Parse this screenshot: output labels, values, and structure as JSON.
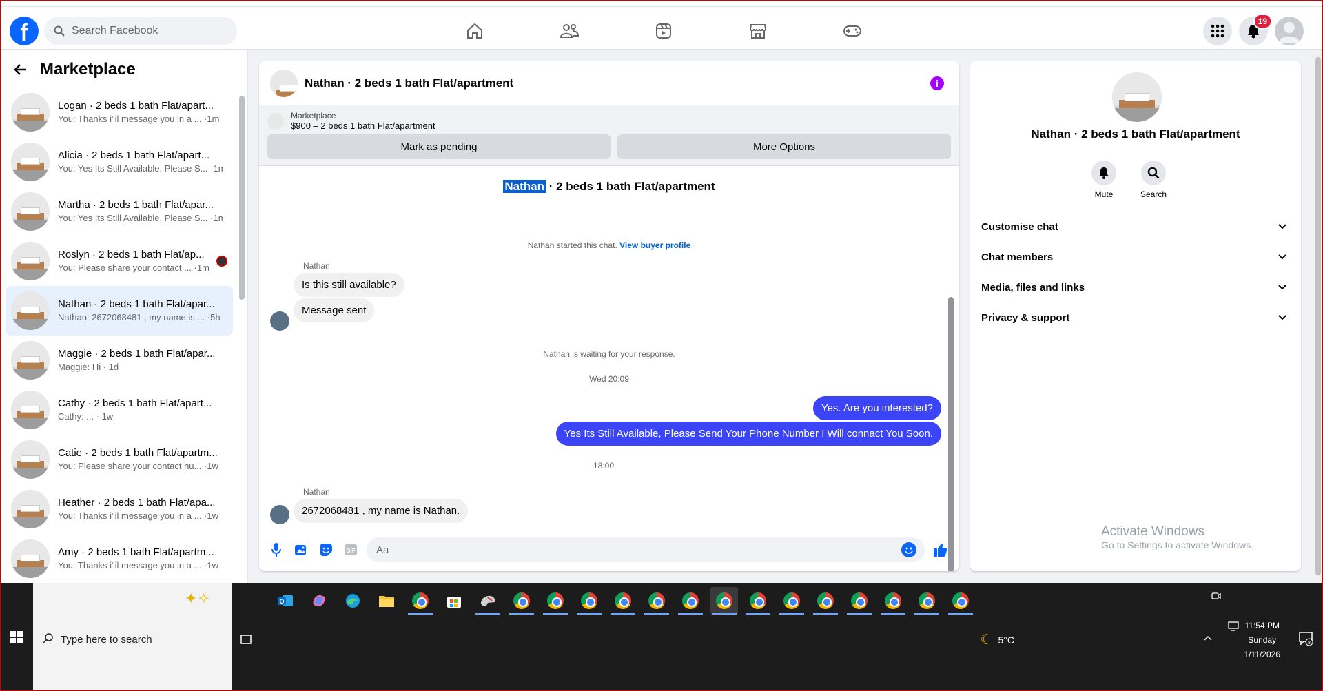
{
  "header": {
    "logo": "f",
    "search_placeholder": "Search Facebook",
    "nav": [
      "home-icon",
      "friends-icon",
      "watch-icon",
      "marketplace-icon",
      "gaming-icon"
    ],
    "notif_count": "19"
  },
  "sidebar": {
    "title": "Marketplace",
    "conversations": [
      {
        "title": "Logan · 2 beds 1 bath Flat/apart...",
        "sub": "You: Thanks i\"il message you in a ... ·1m"
      },
      {
        "title": "Alicia · 2 beds 1 bath Flat/apart...",
        "sub": "You: Yes Its Still Available, Please S... ·1m"
      },
      {
        "title": "Martha · 2 beds 1 bath Flat/apar...",
        "sub": "You: Yes Its Still Available, Please S... ·1m"
      },
      {
        "title": "Roslyn · 2 beds 1 bath Flat/ap...",
        "sub": "You: Please share your contact ... ·1m"
      },
      {
        "title": "Nathan · 2 beds 1 bath Flat/apar...",
        "sub": "Nathan: 2672068481 , my name is ... ·5h"
      },
      {
        "title": "Maggie · 2 beds 1 bath Flat/apar...",
        "sub": "Maggie: Hi · 1d"
      },
      {
        "title": "Cathy · 2 beds 1 bath Flat/apart...",
        "sub": "Cathy: ... · 1w"
      },
      {
        "title": "Catie · 2 beds 1 bath Flat/apartm...",
        "sub": "You: Please share your contact nu... ·1w"
      },
      {
        "title": "Heather · 2 beds 1 bath Flat/apa...",
        "sub": "You: Thanks i\"il message you in a ... ·1w"
      },
      {
        "title": "Amy · 2 beds 1 bath Flat/apartm...",
        "sub": "You: Thanks i\"il message you in a ... ·1w"
      }
    ]
  },
  "chat": {
    "title": "Nathan · 2 beds 1 bath Flat/apartment",
    "listing_label": "Marketplace",
    "listing_price": "$900 – 2 beds 1 bath Flat/apartment",
    "btn_pending": "Mark as pending",
    "btn_more": "More Options",
    "hi_name_sel": "Nathan",
    "hi_name_rest": " · 2 beds 1 bath Flat/apartment",
    "started": "Nathan started this chat.",
    "view_profile": "View buyer profile",
    "sender": "Nathan",
    "msg1": "Is this still available?",
    "msg2": "Message sent",
    "waiting": "Nathan is waiting for your response.",
    "time1": "Wed 20:09",
    "out1": "Yes. Are you interested?",
    "out2": "Yes Its Still Available, Please Send Your Phone Number I Will connact You Soon.",
    "time2": "18:00",
    "sender2": "Nathan",
    "msg3": "2672068481 , my name is Nathan.",
    "input_placeholder": "Aa"
  },
  "details": {
    "title": "Nathan · 2 beds 1 bath Flat/apartment",
    "mute": "Mute",
    "search": "Search",
    "menu": [
      "Customise chat",
      "Chat members",
      "Media, files and links",
      "Privacy & support"
    ],
    "activate1": "Activate Windows",
    "activate2": "Go to Settings to activate Windows."
  },
  "taskbar": {
    "search_text": "Type here to search",
    "weather": "5°C",
    "time": "11:54 PM",
    "day": "Sunday",
    "date": "1/11/2026",
    "notif_count": "8"
  }
}
